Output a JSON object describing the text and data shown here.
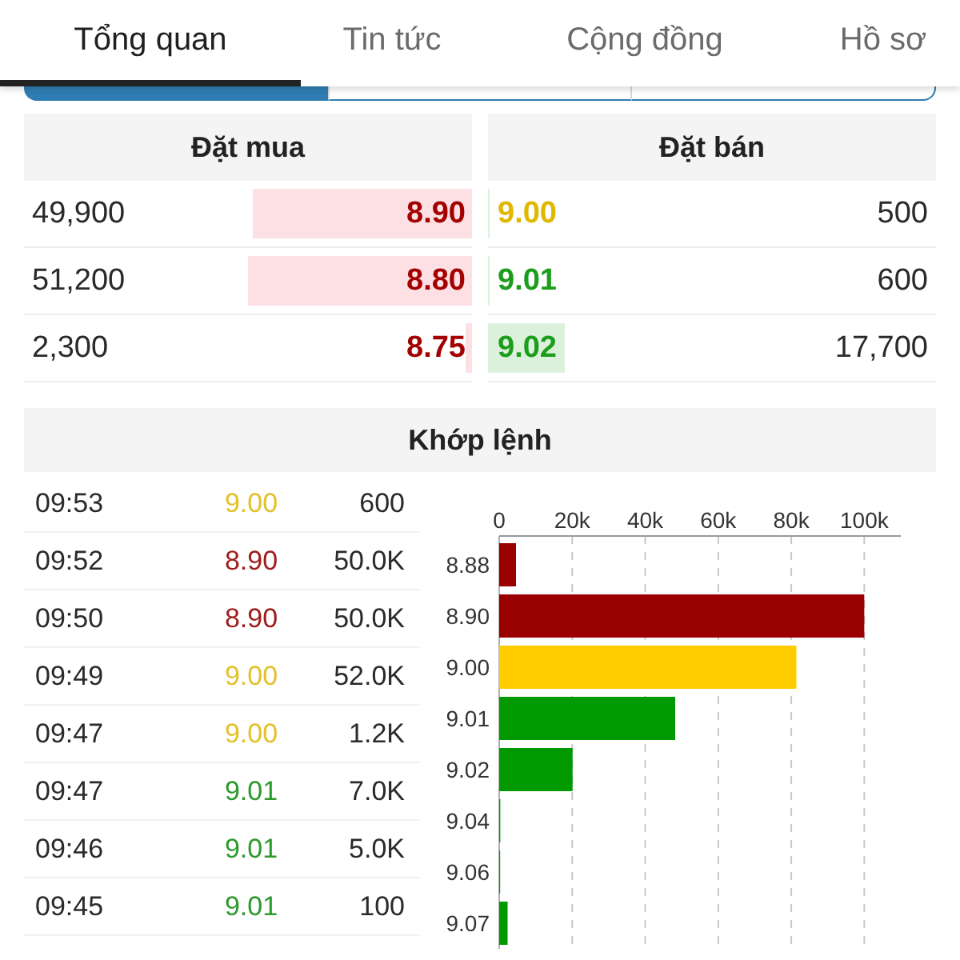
{
  "tabs": [
    {
      "label": "Tổng quan",
      "selected": true
    },
    {
      "label": "Tin tức",
      "selected": false
    },
    {
      "label": "Cộng đồng",
      "selected": false
    },
    {
      "label": "Hồ sơ",
      "selected": false
    }
  ],
  "segmented_control": {
    "segments": [
      {
        "selected": true
      },
      {
        "selected": false
      },
      {
        "selected": false
      }
    ]
  },
  "order_book": {
    "bid_title": "Đặt mua",
    "ask_title": "Đặt bán",
    "rows": [
      {
        "bid": {
          "volume": "49,900",
          "price": "8.90",
          "color": "#a30000",
          "level": 0.49
        },
        "ask": {
          "price": "9.00",
          "color": "#e0b800",
          "level": 0.005,
          "volume": "500"
        }
      },
      {
        "bid": {
          "volume": "51,200",
          "price": "8.80",
          "color": "#a30000",
          "level": 0.5
        },
        "ask": {
          "price": "9.01",
          "color": "#1c9e1c",
          "level": 0.005,
          "volume": "600"
        }
      },
      {
        "bid": {
          "volume": "2,300",
          "price": "8.75",
          "color": "#a30000",
          "level": 0.015
        },
        "ask": {
          "price": "9.02",
          "color": "#1c9e1c",
          "level": 0.17,
          "volume": "17,700"
        }
      }
    ]
  },
  "match": {
    "title": "Khớp lệnh",
    "trades": [
      {
        "time": "09:53",
        "price": "9.00",
        "color": "#e3c12a",
        "volume": "600"
      },
      {
        "time": "09:52",
        "price": "8.90",
        "color": "#a01c1c",
        "volume": "50.0K"
      },
      {
        "time": "09:50",
        "price": "8.90",
        "color": "#a01c1c",
        "volume": "50.0K"
      },
      {
        "time": "09:49",
        "price": "9.00",
        "color": "#e3c12a",
        "volume": "52.0K"
      },
      {
        "time": "09:47",
        "price": "9.00",
        "color": "#e3c12a",
        "volume": "1.2K"
      },
      {
        "time": "09:47",
        "price": "9.01",
        "color": "#2c9a2c",
        "volume": "7.0K"
      },
      {
        "time": "09:46",
        "price": "9.01",
        "color": "#2c9a2c",
        "volume": "5.0K"
      },
      {
        "time": "09:45",
        "price": "9.01",
        "color": "#2c9a2c",
        "volume": "100"
      }
    ],
    "chart_data": {
      "type": "bar",
      "orientation": "horizontal",
      "stacked": true,
      "grid": true,
      "categories": [
        "8.88",
        "8.90",
        "9.00",
        "9.01",
        "9.02",
        "9.04",
        "9.06",
        "9.07"
      ],
      "series": [
        {
          "color": "#990000",
          "values": [
            4600,
            100000,
            null,
            null,
            null,
            null,
            null,
            null
          ]
        },
        {
          "color": "#ffcc00",
          "values": [
            null,
            null,
            81400,
            null,
            null,
            null,
            null,
            null
          ]
        },
        {
          "color": "#009900",
          "values": [
            null,
            null,
            null,
            48200,
            20100,
            300,
            200,
            2300
          ]
        }
      ],
      "xlim": [
        0,
        110000
      ],
      "xticks": [
        {
          "value": 0,
          "label": "0"
        },
        {
          "value": 20000,
          "label": "20k"
        },
        {
          "value": 40000,
          "label": "40k"
        },
        {
          "value": 60000,
          "label": "60k"
        },
        {
          "value": 80000,
          "label": "80k"
        },
        {
          "value": 100000,
          "label": "100k"
        }
      ]
    }
  }
}
